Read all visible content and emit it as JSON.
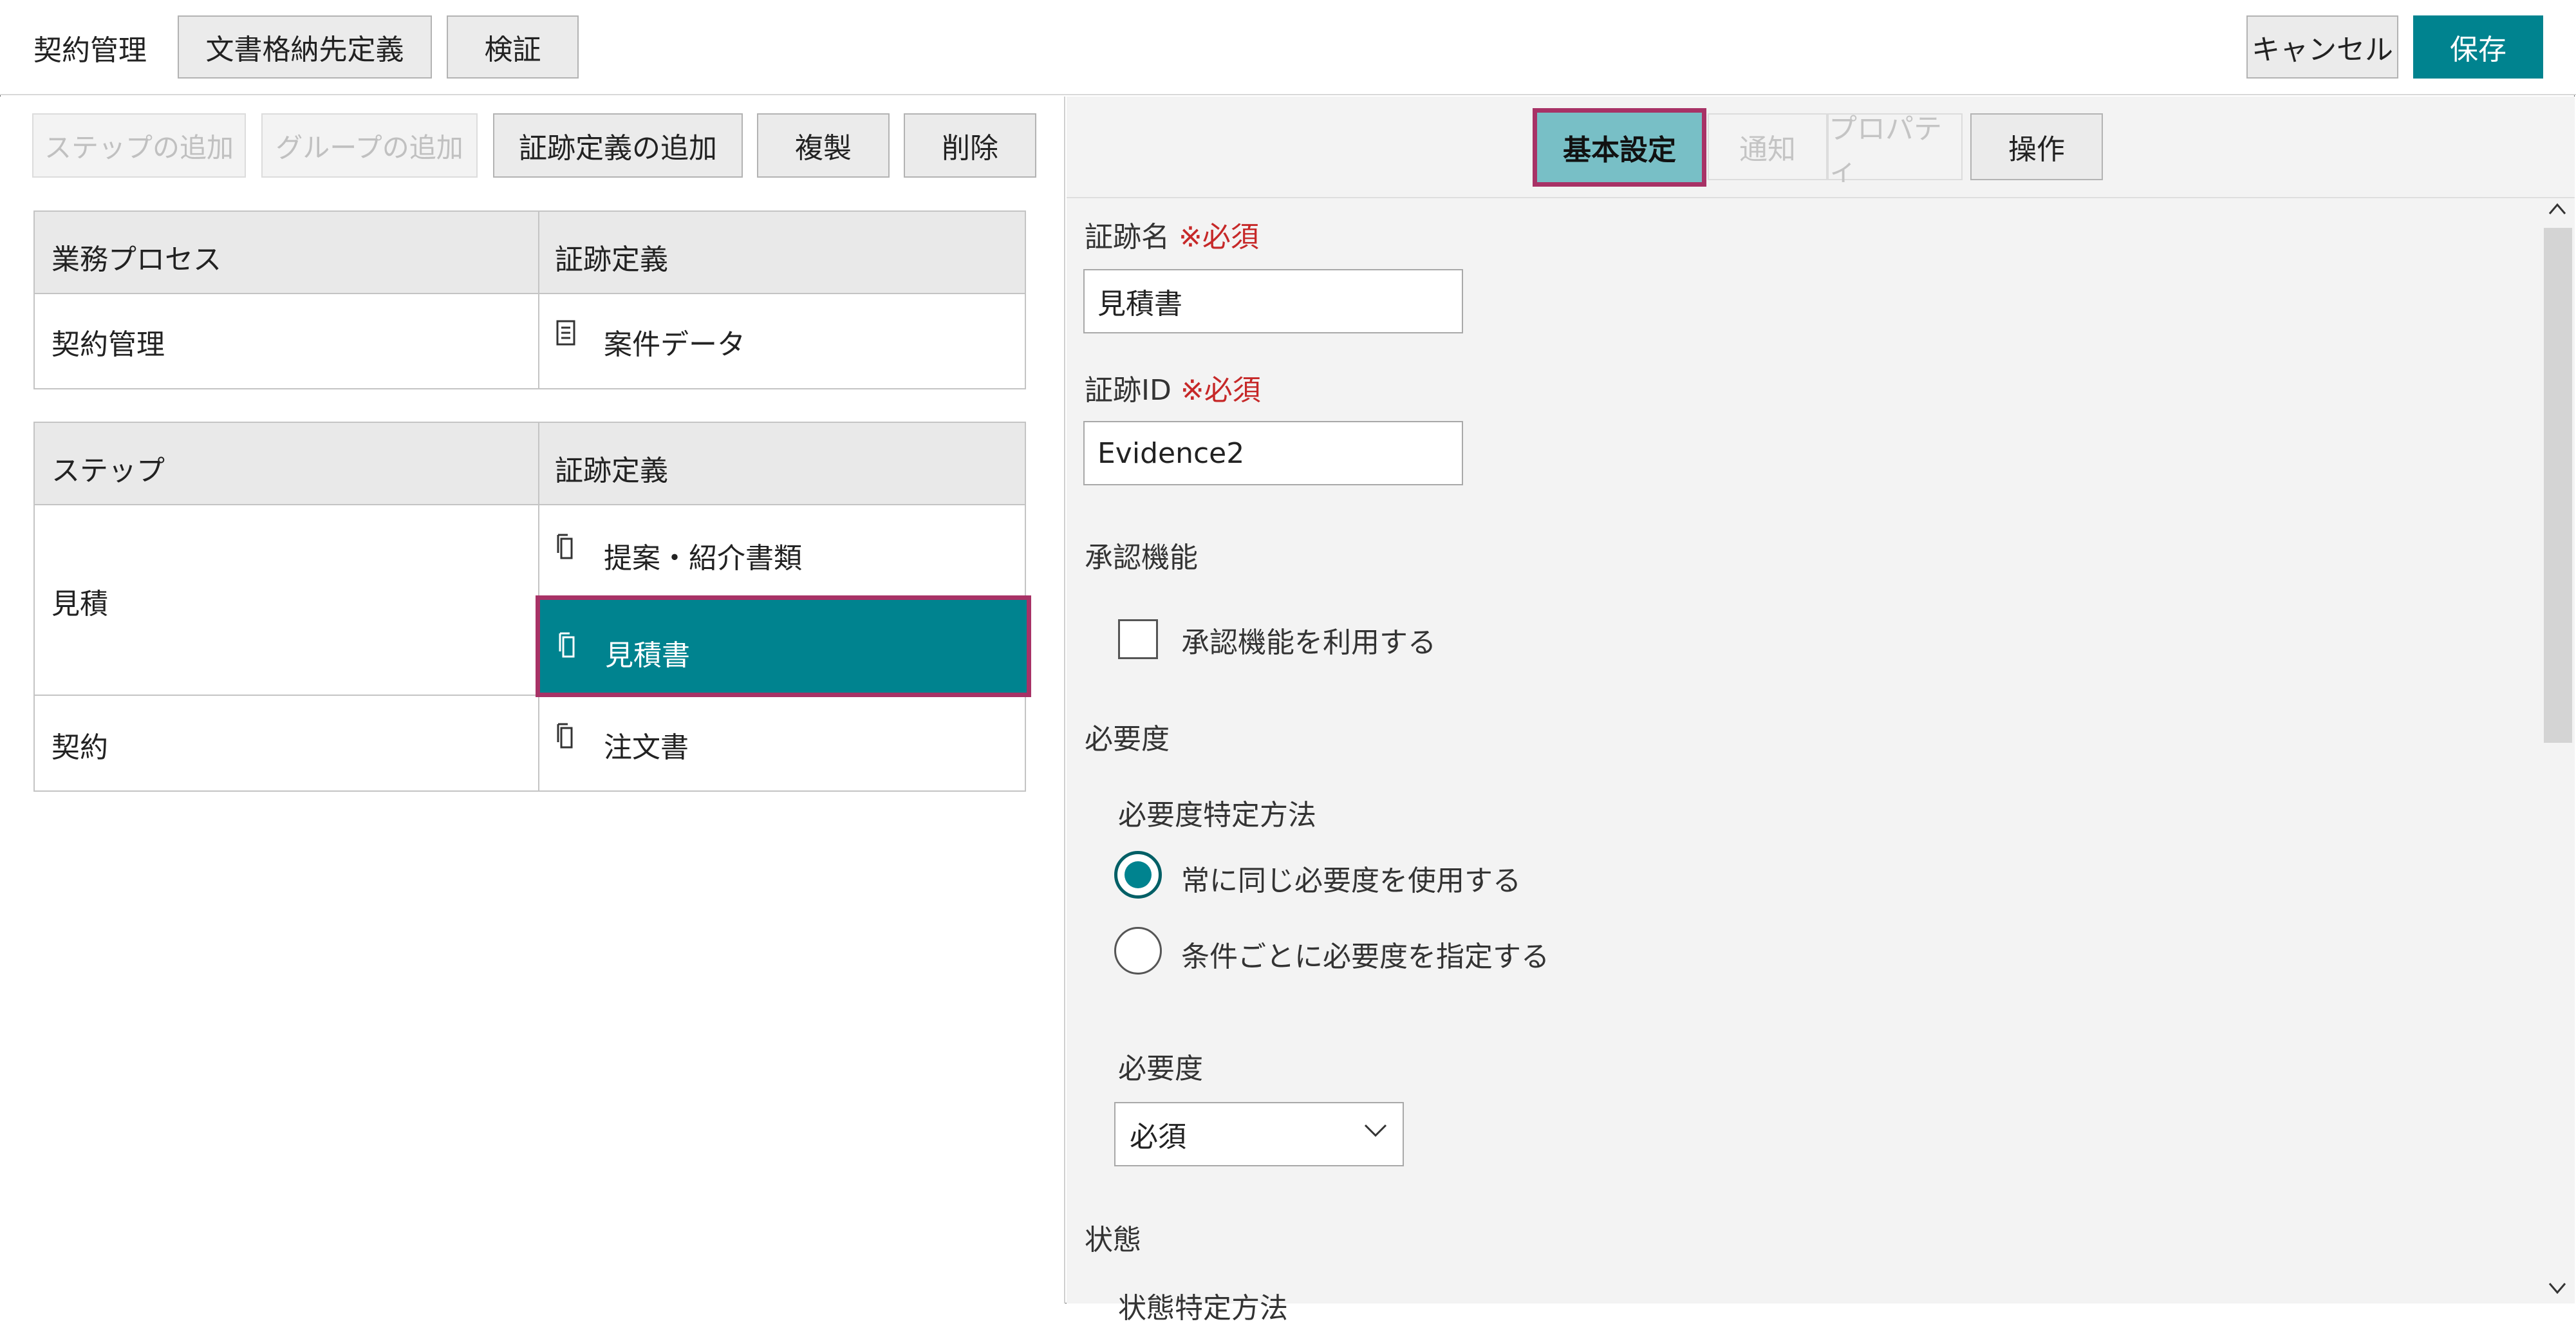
{
  "header": {
    "title": "契約管理",
    "doc_storage_button": "文書格納先定義",
    "validate_button": "検証",
    "cancel_button": "キャンセル",
    "save_button": "保存"
  },
  "toolbar": {
    "add_step": "ステップの追加",
    "add_group": "グループの追加",
    "add_evidence": "証跡定義の追加",
    "duplicate": "複製",
    "delete": "削除"
  },
  "process_table": {
    "col_process": "業務プロセス",
    "col_evidence": "証跡定義",
    "row": {
      "process": "契約管理",
      "evidence": "案件データ"
    }
  },
  "step_table": {
    "col_step": "ステップ",
    "col_evidence": "証跡定義",
    "rows": [
      {
        "step": "見積",
        "evidences": [
          "提案・紹介書類",
          "見積書"
        ]
      },
      {
        "step": "契約",
        "evidences": [
          "注文書"
        ]
      }
    ]
  },
  "tabs": {
    "basic": "基本設定",
    "notify": "通知",
    "property": "プロパティ",
    "operation": "操作"
  },
  "form": {
    "required_mark": "※必須",
    "evidence_name_label": "証跡名",
    "evidence_name_value": "見積書",
    "evidence_id_label": "証跡ID",
    "evidence_id_value": "Evidence2",
    "approval_section": "承認機能",
    "approval_checkbox": "承認機能を利用する",
    "necessity_section": "必要度",
    "necessity_method_label": "必要度特定方法",
    "radio_same": "常に同じ必要度を使用する",
    "radio_conditional": "条件ごとに必要度を指定する",
    "necessity_label": "必要度",
    "necessity_select": "必須",
    "status_section": "状態",
    "status_method_label": "状態特定方法"
  },
  "colors": {
    "accent": "#00838f",
    "highlight_border": "#a83266",
    "required": "#c62828"
  }
}
